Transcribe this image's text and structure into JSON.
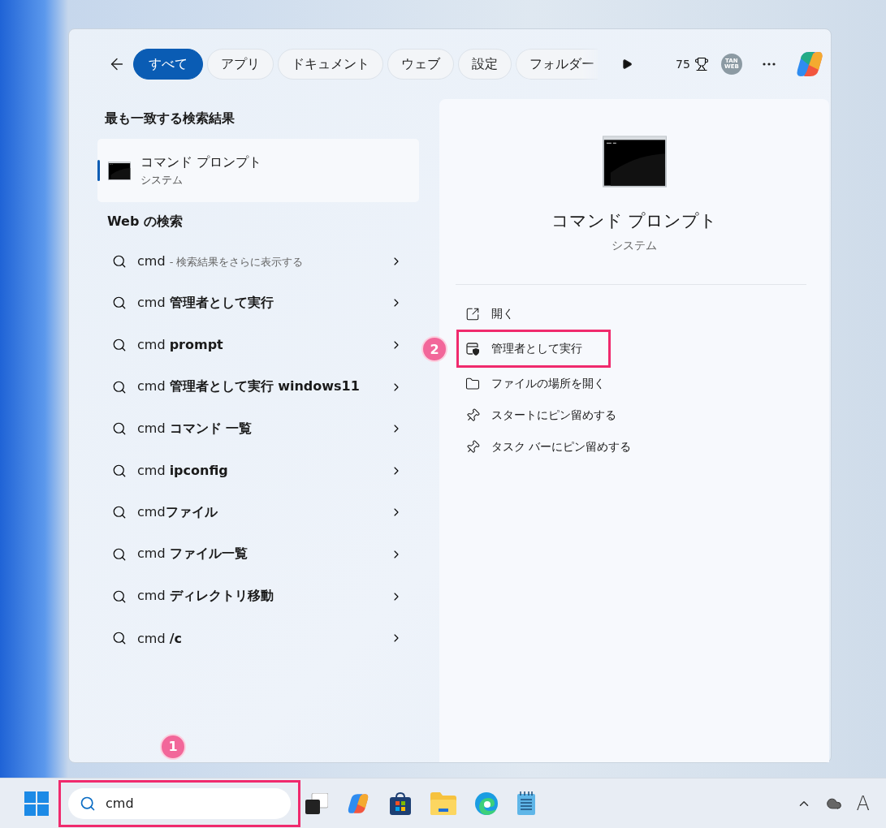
{
  "filters": [
    {
      "label": "すべて",
      "selected": true,
      "faded": false
    },
    {
      "label": "アプリ",
      "selected": false,
      "faded": false
    },
    {
      "label": "ドキュメント",
      "selected": false,
      "faded": false
    },
    {
      "label": "ウェブ",
      "selected": false,
      "faded": false
    },
    {
      "label": "設定",
      "selected": false,
      "faded": false
    },
    {
      "label": "フォルダー",
      "selected": false,
      "faded": true
    }
  ],
  "points": "75",
  "avatar": [
    "TAN",
    "WEB"
  ],
  "best_match": {
    "heading": "最も一致する検索結果",
    "title": "コマンド プロンプト",
    "subtitle": "システム",
    "selected": true
  },
  "web_search": {
    "heading": "Web の検索",
    "items": [
      {
        "kind": "more",
        "text": "cmd",
        "note": "- 検索結果をさらに表示する"
      },
      {
        "kind": "suggestion",
        "text": "cmd **管理者として実行**"
      },
      {
        "kind": "suggestion",
        "text": "cmd **prompt**"
      },
      {
        "kind": "suggestion",
        "text": "cmd **管理者として実行 windows11**"
      },
      {
        "kind": "suggestion",
        "text": "cmd **コマンド 一覧**"
      },
      {
        "kind": "suggestion",
        "text": "cmd **ipconfig**"
      },
      {
        "kind": "suggestion",
        "text": "cmd**ファイル**"
      },
      {
        "kind": "suggestion",
        "text": "cmd **ファイル一覧**"
      },
      {
        "kind": "suggestion",
        "text": "cmd **ディレクトリ移動**"
      },
      {
        "kind": "suggestion",
        "text": "cmd **/c**"
      }
    ]
  },
  "detail": {
    "title": "コマンド プロンプト",
    "subtitle": "システム",
    "actions": [
      {
        "kind": "open",
        "label": "開く",
        "highlighted": false
      },
      {
        "kind": "admin",
        "label": "管理者として実行",
        "highlighted": true,
        "marker": "2"
      },
      {
        "kind": "folder",
        "label": "ファイルの場所を開く",
        "highlighted": false
      },
      {
        "kind": "pin",
        "label": "スタートにピン留めする",
        "highlighted": false
      },
      {
        "kind": "pin",
        "label": "タスク バーにピン留めする",
        "highlighted": false
      }
    ]
  },
  "taskbar": {
    "search": {
      "value": "cmd",
      "highlighted": true,
      "marker": "1"
    },
    "tray": {
      "keyboard": "A"
    }
  }
}
